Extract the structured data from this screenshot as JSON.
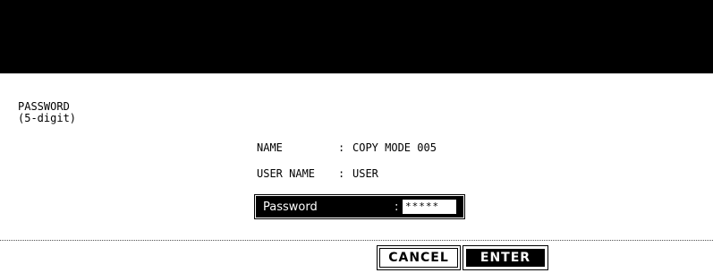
{
  "prompt": {
    "title": "PASSWORD",
    "subtitle": "(5-digit)"
  },
  "info": {
    "name_label": "NAME",
    "name_value": "COPY MODE 005",
    "user_label": "USER NAME",
    "user_value": "USER",
    "separator": ":"
  },
  "password": {
    "label": "Password",
    "colon": ":",
    "value": "*****"
  },
  "buttons": {
    "cancel_label": "CANCEL",
    "enter_label": "ENTER"
  },
  "colors": {
    "header": "#000000",
    "background": "#ffffff",
    "text": "#000000"
  }
}
